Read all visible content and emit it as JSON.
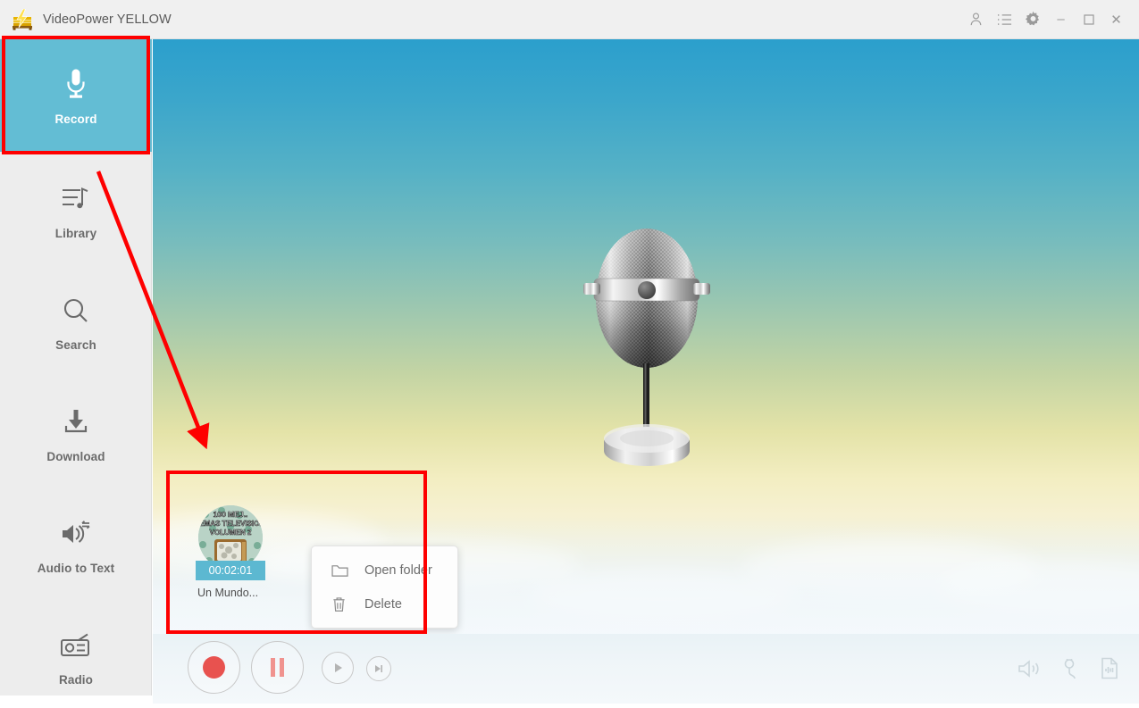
{
  "window": {
    "title": "VideoPower YELLOW",
    "app_icon": "vise-lightning-icon",
    "controls": {
      "account": "account-icon",
      "list": "list-icon",
      "settings": "gear-icon",
      "minimize": "–",
      "maximize": "☐",
      "close": "✕"
    }
  },
  "sidebar": {
    "items": [
      {
        "id": "record",
        "label": "Record",
        "icon": "microphone-icon",
        "active": true
      },
      {
        "id": "library",
        "label": "Library",
        "icon": "playlist-music-icon",
        "active": false
      },
      {
        "id": "search",
        "label": "Search",
        "icon": "magnifier-icon",
        "active": false
      },
      {
        "id": "download",
        "label": "Download",
        "icon": "download-arrow-icon",
        "active": false
      },
      {
        "id": "audiototext",
        "label": "Audio to Text",
        "icon": "speaker-convert-icon",
        "active": false
      },
      {
        "id": "radio",
        "label": "Radio",
        "icon": "radio-icon",
        "active": false
      }
    ],
    "active_bg": "#63bdd4"
  },
  "main": {
    "illustration": "vintage-ribbon-microphone",
    "background": "sky-gradient-blue-to-yellow-with-clouds"
  },
  "recording": {
    "thumbnail_art": {
      "line1": "100 MEJ...",
      "line2": "EMAS TELEVISIO...",
      "line3": "VOLUMEN 2",
      "image": "retro-television-album-cover"
    },
    "duration": "00:02:01",
    "name": "Un  Mundo...",
    "duration_bg": "#5cb8d1"
  },
  "context_menu": {
    "items": [
      {
        "id": "open-folder",
        "label": "Open folder",
        "icon": "folder-icon"
      },
      {
        "id": "delete",
        "label": "Delete",
        "icon": "trash-icon"
      }
    ]
  },
  "transport": {
    "buttons": [
      {
        "id": "record",
        "icon": "record-circle-icon",
        "color": "#e8524f"
      },
      {
        "id": "pause",
        "icon": "pause-icon",
        "color": "#f0938f"
      },
      {
        "id": "play",
        "icon": "play-icon",
        "color": "#b9b9b9"
      },
      {
        "id": "next",
        "icon": "skip-next-icon",
        "color": "#b9b9b9"
      }
    ],
    "right_icons": [
      {
        "id": "volume",
        "icon": "speaker-icon"
      },
      {
        "id": "input-source",
        "icon": "microphone-plug-icon"
      },
      {
        "id": "output-format",
        "icon": "file-waveform-icon"
      }
    ]
  },
  "annotations": {
    "color": "#fe0000",
    "boxes": [
      {
        "id": "record-nav-highlight"
      },
      {
        "id": "recording-item-highlight"
      }
    ],
    "arrow": {
      "id": "pointer-arrow",
      "from": "library-area",
      "to": "recording-item"
    }
  }
}
